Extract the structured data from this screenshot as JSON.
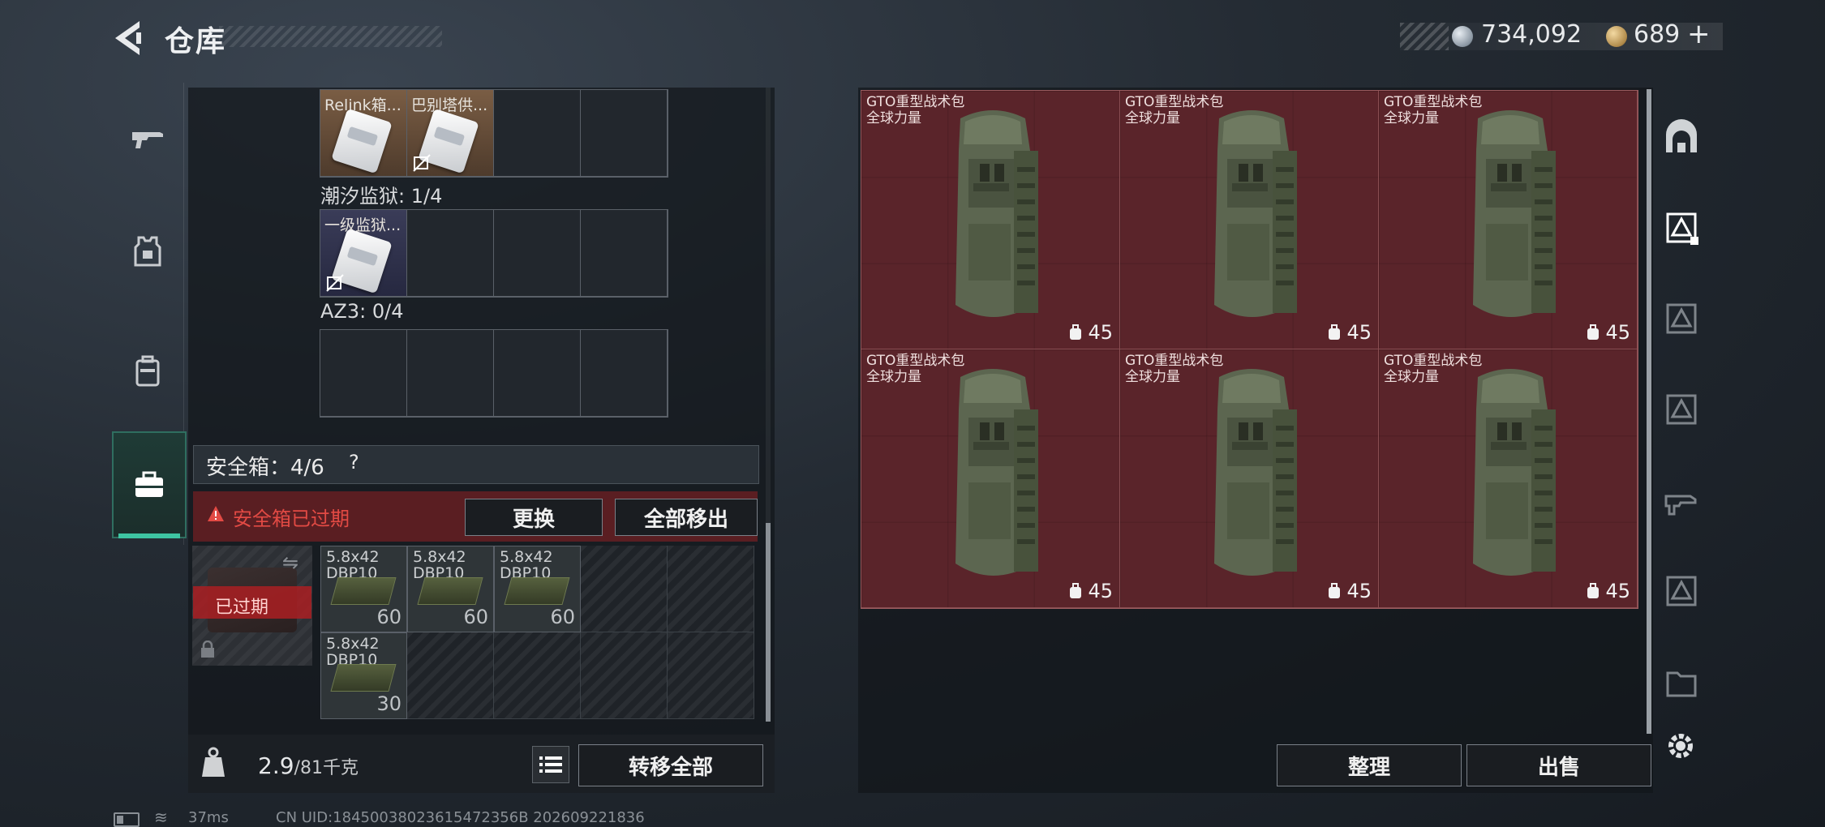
{
  "header": {
    "title": "仓库",
    "currency_a": "734,092",
    "currency_b": "689",
    "plus": "+"
  },
  "left_tabs": [
    {
      "icon": "rifle-icon"
    },
    {
      "icon": "armor-vest-icon"
    },
    {
      "icon": "backpack-icon"
    },
    {
      "icon": "briefcase-icon",
      "active": true
    }
  ],
  "containers": {
    "slot1_items": [
      {
        "label": "Relink箱...",
        "nosell": false
      },
      {
        "label": "巴别塔供...",
        "nosell": true
      }
    ],
    "section2_label": "潮汐监狱: 1/4",
    "slot2_items": [
      {
        "label": "一级监狱...",
        "nosell": true
      }
    ],
    "section3_label": "AZ3: 0/4"
  },
  "safe_box": {
    "label": "安全箱：4/6",
    "help": "?",
    "expired_notice": "安全箱已过期",
    "swap_button": "更换",
    "move_all_button": "全部移出",
    "expired_tag": "已过期",
    "items": [
      {
        "name": "5.8x42\nDBP10",
        "qty": "60"
      },
      {
        "name": "5.8x42\nDBP10",
        "qty": "60"
      },
      {
        "name": "5.8x42\nDBP10",
        "qty": "60"
      },
      {
        "name": "5.8x42\nDBP10",
        "qty": "30"
      }
    ]
  },
  "footer_left": {
    "weight_current": "2.9",
    "weight_max": "/81千克",
    "transfer_all_button": "转移全部"
  },
  "stash": {
    "items": [
      {
        "name": "GTO重型战术包",
        "sub": "全球力量",
        "capacity": "45"
      },
      {
        "name": "GTO重型战术包",
        "sub": "全球力量",
        "capacity": "45"
      },
      {
        "name": "GTO重型战术包",
        "sub": "全球力量",
        "capacity": "45"
      },
      {
        "name": "GTO重型战术包",
        "sub": "全球力量",
        "capacity": "45"
      },
      {
        "name": "GTO重型战术包",
        "sub": "全球力量",
        "capacity": "45"
      },
      {
        "name": "GTO重型战术包",
        "sub": "全球力量",
        "capacity": "45"
      }
    ],
    "sort_button": "整理",
    "sell_button": "出售"
  },
  "status_bar": {
    "ping": "37ms",
    "uid": "CN UID:18450038023615472356B 202609221836"
  },
  "colors": {
    "accent": "#3ec4a2",
    "expired_red": "#e24a44",
    "stash_cell": "#5a242a"
  }
}
